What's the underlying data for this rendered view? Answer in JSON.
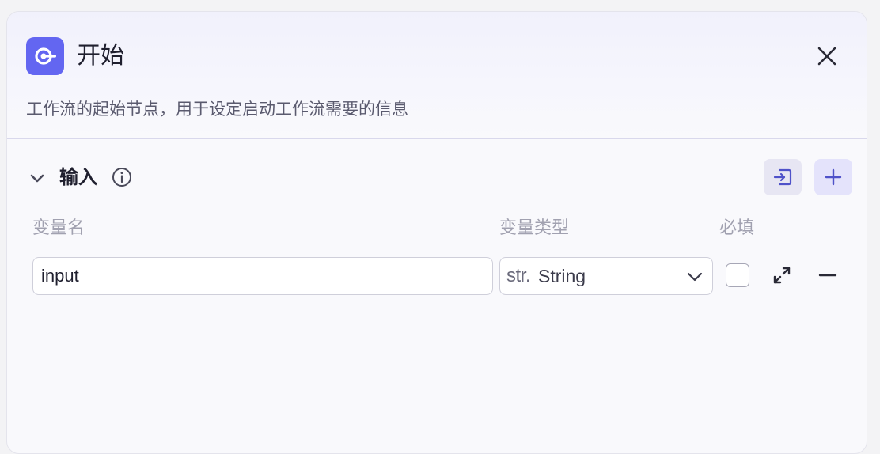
{
  "node": {
    "title": "开始",
    "description": "工作流的起始节点，用于设定启动工作流需要的信息",
    "icon": "start-node-icon",
    "accent_color": "#6366f1"
  },
  "header": {
    "close_icon": "close-icon"
  },
  "input_section": {
    "title": "输入",
    "info_icon": "info-icon",
    "import_icon": "import-icon",
    "add_icon": "plus-icon",
    "columns": {
      "name": "变量名",
      "type": "变量类型",
      "required": "必填"
    },
    "rows": [
      {
        "name": "input",
        "type_prefix": "str.",
        "type": "String",
        "required": false
      }
    ]
  }
}
